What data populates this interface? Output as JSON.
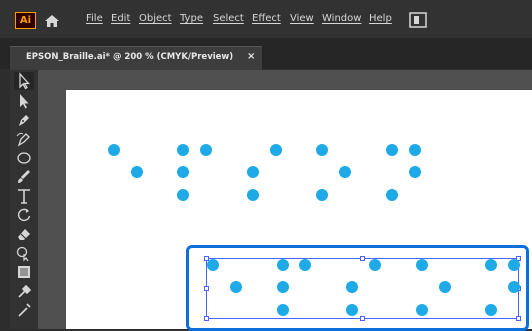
{
  "app": {
    "logo_text": "Ai",
    "accent": "#ff9a00",
    "home_icon": "home-icon",
    "arrange_icon": "arrange-documents-icon"
  },
  "menu": [
    "File",
    "Edit",
    "Object",
    "Type",
    "Select",
    "Effect",
    "View",
    "Window",
    "Help"
  ],
  "panel_collapse_label": "»",
  "document_tab": {
    "title": "EPSON_Braille.ai* @ 200 % (CMYK/Preview)",
    "close_label": "×"
  },
  "tools": [
    "selection-tool-icon",
    "direct-selection-tool-icon",
    "pen-tool-icon",
    "curvature-tool-icon",
    "ellipse-tool-icon",
    "paintbrush-tool-icon",
    "type-tool-icon",
    "rotate-tool-icon",
    "eraser-tool-icon",
    "shape-builder-tool-icon",
    "artboard-tool-icon",
    "eyedropper-tool-icon",
    "eyedropper-tool-icon"
  ],
  "colors": {
    "dot": "#1ea9e7",
    "highlight": "#0d6fdc",
    "selection": "#4a62ff"
  }
}
